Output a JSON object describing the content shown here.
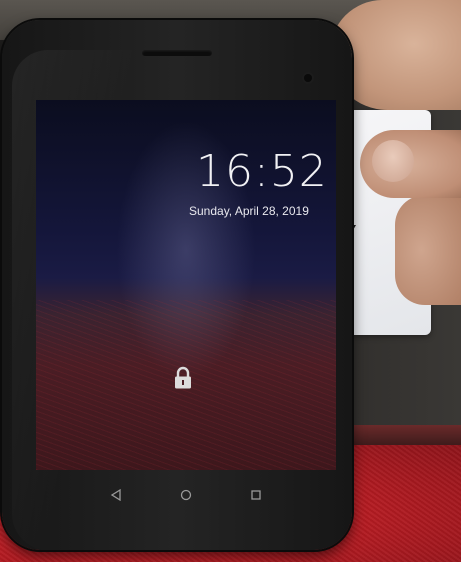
{
  "lock_screen": {
    "time": "16:52",
    "date": "Sunday, April 28, 2019",
    "lock_icon": "lock-icon"
  },
  "navigation_bar": {
    "back_icon": "back-triangle-icon",
    "home_icon": "home-circle-icon",
    "recents_icon": "recents-square-icon"
  },
  "colors": {
    "clock_text": "#f1f1f4",
    "nav_icons": "#9a9a9a",
    "cloth": "#c41f26"
  }
}
